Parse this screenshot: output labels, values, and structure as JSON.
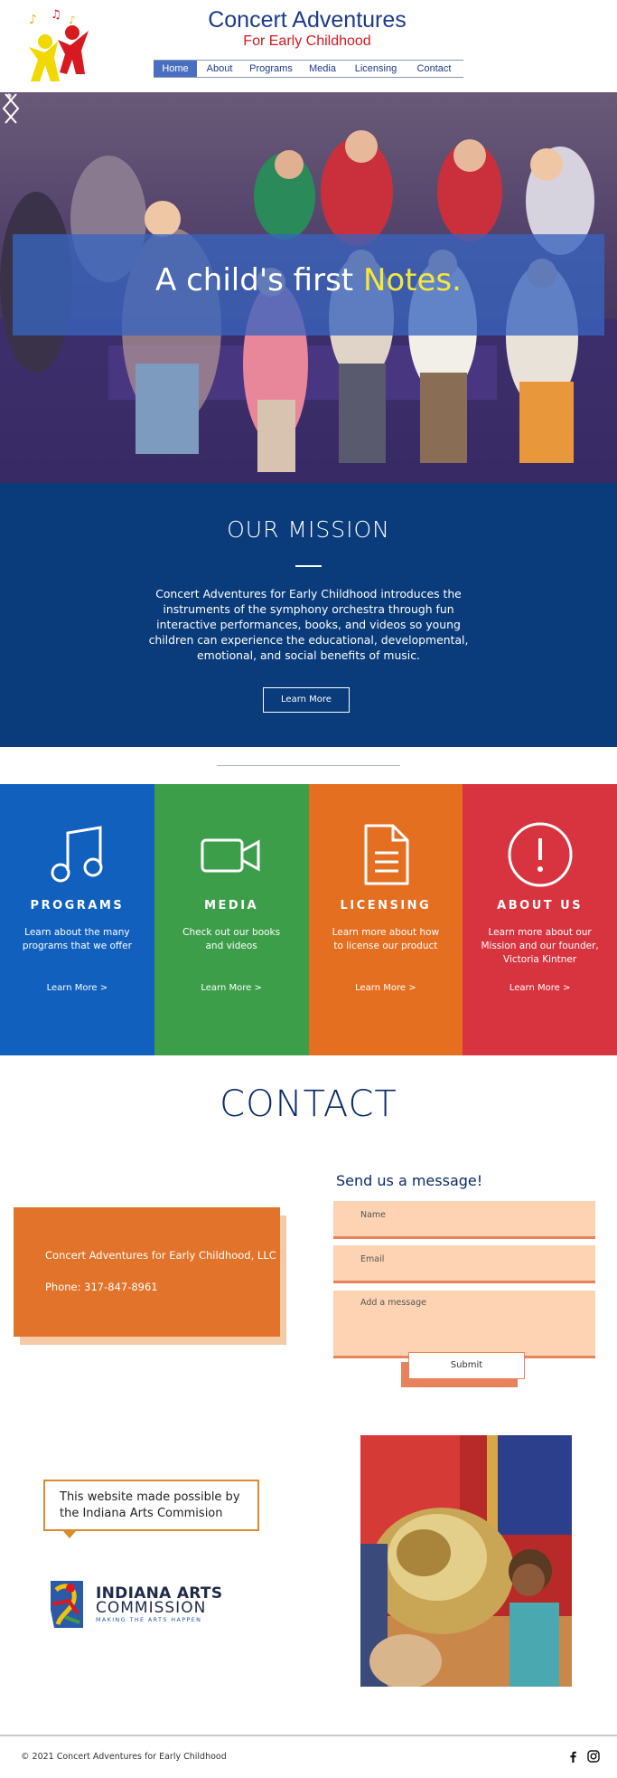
{
  "header": {
    "title": "Concert Adventures",
    "subtitle": "For Early Childhood",
    "nav": [
      {
        "label": "Home",
        "active": true
      },
      {
        "label": "About",
        "active": false
      },
      {
        "label": "Programs",
        "active": false
      },
      {
        "label": "Media",
        "active": false
      },
      {
        "label": "Licensing",
        "active": false
      },
      {
        "label": "Contact",
        "active": false
      }
    ]
  },
  "hero": {
    "headline_prefix": "A child's first ",
    "headline_highlight": "Notes.",
    "prev_icon": "chevron-left-icon",
    "next_icon": "chevron-right-icon"
  },
  "mission": {
    "title": "OUR MISSION",
    "text": "Concert Adventures for Early Childhood introduces the instruments of the symphony orchestra through fun interactive performances, books, and videos so young children can experience the educational, developmental, emotional, and social benefits of music.",
    "button_label": "Learn More"
  },
  "tiles": [
    {
      "title": "PROGRAMS",
      "description": "Learn about the many programs that we offer",
      "link": "Learn More >",
      "color": "#1160be",
      "icon": "music-note-icon"
    },
    {
      "title": "MEDIA",
      "description": "Check out our books and videos",
      "link": "Learn More >",
      "color": "#3d9e4a",
      "icon": "video-camera-icon"
    },
    {
      "title": "LICENSING",
      "description": "Learn more about how to license our product",
      "link": "Learn More >",
      "color": "#e46f21",
      "icon": "document-icon"
    },
    {
      "title": "ABOUT US",
      "description": "Learn more about our Mission and our founder, Victoria Kintner",
      "link": "Learn More >",
      "color": "#d8343f",
      "icon": "info-exclamation-icon"
    }
  ],
  "contact": {
    "heading": "CONTACT",
    "company": "Concert Adventures for Early Childhood, LLC",
    "phone": "Phone: 317-847-8961",
    "form_title": "Send us a message!",
    "name_placeholder": "Name",
    "email_placeholder": "Email",
    "message_placeholder": "Add a message",
    "submit_label": "Submit"
  },
  "arts": {
    "callout": "This website made possible by the Indiana Arts Commision",
    "logo_line1": "INDIANA ARTS",
    "logo_line2": "COMMISSION",
    "logo_tagline": "MAKING THE ARTS HAPPEN"
  },
  "footer": {
    "copyright": "© 2021 Concert Adventures for Early Childhood",
    "social": [
      "facebook-icon",
      "instagram-icon"
    ]
  },
  "colors": {
    "brand_blue": "#1c3b8a",
    "brand_red": "#d71920",
    "mission_bg": "#0a3b7a",
    "contact_orange": "#e2732a",
    "form_field": "#fdd3b4"
  }
}
